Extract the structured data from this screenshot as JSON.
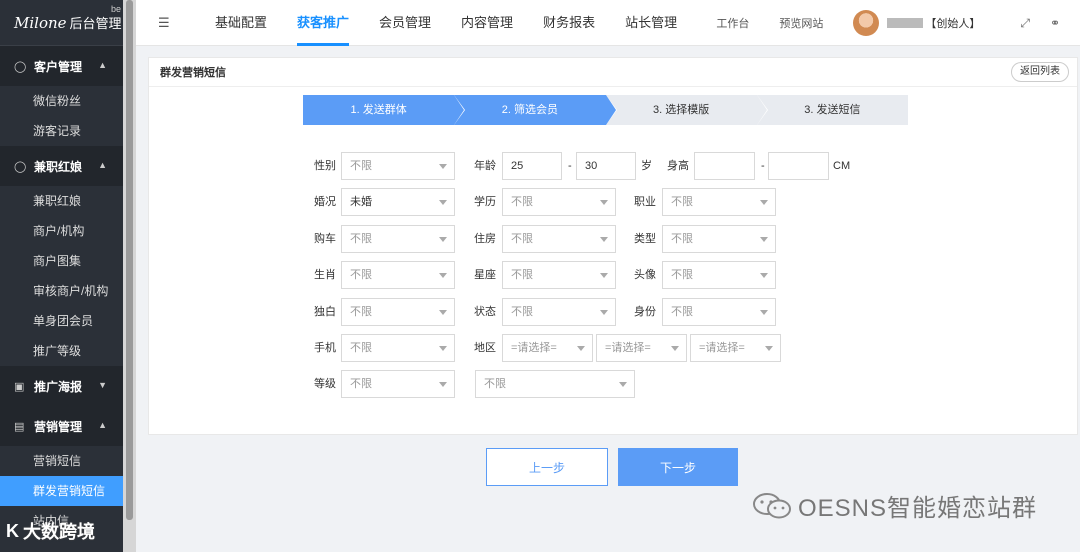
{
  "logo": {
    "brand": "Milone",
    "brand_cn": "后台管理",
    "badge": "be"
  },
  "sidebar": {
    "groups": [
      {
        "label": "客户管理",
        "items": [
          "微信粉丝",
          "游客记录"
        ]
      },
      {
        "label": "兼职红娘",
        "items": [
          "兼职红娘",
          "商户/机构",
          "商户图集",
          "审核商户/机构",
          "单身团会员",
          "推广等级"
        ]
      },
      {
        "label": "推广海报",
        "items": []
      },
      {
        "label": "营销管理",
        "items": [
          "营销短信",
          "群发营销短信",
          "站内信"
        ]
      }
    ]
  },
  "topnav": {
    "items": [
      "基础配置",
      "获客推广",
      "会员管理",
      "内容管理",
      "财务报表",
      "站长管理"
    ],
    "active_index": 1
  },
  "topright": {
    "workbench": "工作台",
    "preview": "预览网站",
    "role": "【创始人】"
  },
  "card": {
    "title": "群发营销短信",
    "back_label": "返回列表"
  },
  "steps": [
    "1. 发送群体",
    "2. 筛选会员",
    "3. 选择模版",
    "3. 发送短信"
  ],
  "form": {
    "gender": {
      "label": "性别",
      "value": "不限"
    },
    "age": {
      "label": "年龄",
      "min": "25",
      "dash": "-",
      "max": "30",
      "unit": "岁"
    },
    "height": {
      "label": "身高",
      "min": "",
      "dash": "-",
      "max": "",
      "unit": "CM"
    },
    "marriage": {
      "label": "婚况",
      "value": "未婚"
    },
    "education": {
      "label": "学历",
      "value": "不限"
    },
    "job": {
      "label": "职业",
      "value": "不限"
    },
    "car": {
      "label": "购车",
      "value": "不限"
    },
    "house": {
      "label": "住房",
      "value": "不限"
    },
    "type": {
      "label": "类型",
      "value": "不限"
    },
    "zodiac": {
      "label": "生肖",
      "value": "不限"
    },
    "constellation": {
      "label": "星座",
      "value": "不限"
    },
    "avatar": {
      "label": "头像",
      "value": "不限"
    },
    "monologue": {
      "label": "独白",
      "value": "不限"
    },
    "status": {
      "label": "状态",
      "value": "不限"
    },
    "identity": {
      "label": "身份",
      "value": "不限"
    },
    "phone": {
      "label": "手机",
      "value": "不限"
    },
    "region": {
      "label": "地区",
      "p1": "=请选择=",
      "p2": "=请选择=",
      "p3": "=请选择="
    },
    "level": {
      "label": "等级",
      "value": "不限"
    },
    "extra": {
      "value": "不限"
    }
  },
  "buttons": {
    "prev": "上一步",
    "next": "下一步"
  },
  "watermarks": {
    "right": "OESNS智能婚恋站群",
    "left_logo": "K",
    "left": "大数跨境"
  },
  "colors": {
    "primary": "#5b9cf6",
    "sidebar_bg": "#2b3038",
    "active_nav": "#1890ff"
  }
}
